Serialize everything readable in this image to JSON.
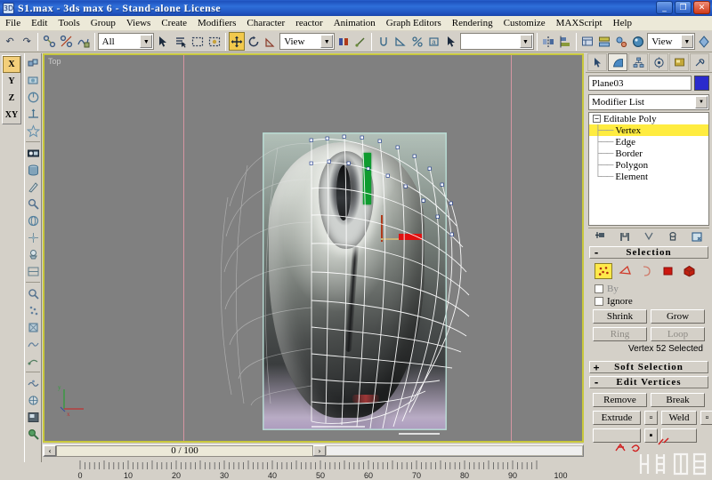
{
  "window": {
    "title": "S1.max - 3ds max 6 - Stand-alone License",
    "app_icon": "max-app-icon",
    "minimize_label": "_",
    "restore_label": "❐",
    "close_label": "✕"
  },
  "menu": {
    "items": [
      "File",
      "Edit",
      "Tools",
      "Group",
      "Views",
      "Create",
      "Modifiers",
      "Character",
      "reactor",
      "Animation",
      "Graph Editors",
      "Rendering",
      "Customize",
      "MAXScript",
      "Help"
    ]
  },
  "toolbar": {
    "undo": "↶",
    "redo": "↷",
    "select_link": "link-icon",
    "unlink": "unlink-icon",
    "bind_space_warp": "bind-icon",
    "selection_filter": "All",
    "select_object": "➤",
    "select_by_name": "name-icon",
    "rect_select": "rect-select-icon",
    "window_crossing": "crossing-icon",
    "select_move": "✥",
    "select_rotate": "↻",
    "select_scale": "scale-icon",
    "ref_coord_sys": "View",
    "use_pivot": "pivot-icon",
    "mirror": "mirror-icon",
    "align": "align-icon",
    "layers": "layers-icon",
    "curve_editor": "curve-icon",
    "schematic": "schematic-icon",
    "material_editor": "material-icon",
    "render_scene": "render-icon",
    "render_type": "View",
    "quick_render": "quick-render-icon",
    "named_selection_sets": ""
  },
  "axis_constraints": {
    "items": [
      "X",
      "Y",
      "Z",
      "XY"
    ],
    "active": "X"
  },
  "left_toolbar": {
    "icons": [
      "array-icon",
      "snapshot-icon",
      "spacing-icon",
      "align-normal-icon",
      "place-highlight-icon",
      "material-editor-icon",
      "render-scene-icon",
      "quick-render-icon",
      "render-last-icon",
      "environment-icon",
      "effects-icon",
      "advanced-lighting-icon",
      "ram-player-icon",
      "asset-browser-icon",
      "particle-view-icon",
      "reactor-icon",
      "tape-icon",
      "measure-icon",
      "channel-info-icon",
      "snaps-icon",
      "grid-icon",
      "display-floater-icon",
      "light-lister-icon"
    ]
  },
  "viewport": {
    "label": "Top",
    "active_border_color": "#c8c83c",
    "background_color": "#808080",
    "reference_image": "computer-mouse-photo",
    "mesh_object": "Plane03 editable poly wireframe",
    "tripod": {
      "x_label": "x",
      "y_label": "y",
      "x_color": "#c03030",
      "y_color": "#2f9c3a"
    }
  },
  "timeline": {
    "current_frame_text": "0 / 100",
    "prev_label": "‹",
    "next_label": "›",
    "ruler_labels": [
      "0",
      "10",
      "20",
      "30",
      "40",
      "50",
      "60",
      "70",
      "80",
      "90",
      "100"
    ],
    "range_start": 0,
    "range_end": 100,
    "slider_position": 0
  },
  "command_panel": {
    "tabs": [
      {
        "name": "create-tab",
        "glyph": "↖",
        "active": false
      },
      {
        "name": "modify-tab",
        "glyph": "◠",
        "active": true
      },
      {
        "name": "hierarchy-tab",
        "glyph": "⛓",
        "active": false
      },
      {
        "name": "motion-tab",
        "glyph": "◎",
        "active": false
      },
      {
        "name": "display-tab",
        "glyph": "▤",
        "active": false
      },
      {
        "name": "utilities-tab",
        "glyph": "⚒",
        "active": false
      }
    ],
    "object_name": "Plane03",
    "object_color": "#2a2acd",
    "modifier_list_label": "Modifier List",
    "stack": [
      {
        "label": "Editable Poly",
        "level": 0,
        "expanded": true,
        "selected": false
      },
      {
        "label": "Vertex",
        "level": 1,
        "selected": true
      },
      {
        "label": "Edge",
        "level": 1,
        "selected": false
      },
      {
        "label": "Border",
        "level": 1,
        "selected": false
      },
      {
        "label": "Polygon",
        "level": 1,
        "selected": false
      },
      {
        "label": "Element",
        "level": 1,
        "selected": false
      }
    ],
    "stack_tools": [
      "pin-stack-icon",
      "show-end-result-icon",
      "make-unique-icon",
      "remove-modifier-icon",
      "configure-sets-icon"
    ],
    "selection_rollout": {
      "title": "Selection",
      "sign": "-",
      "sub_object_icons": [
        {
          "name": "vertex-sub-object",
          "glyph": "∷",
          "active": true
        },
        {
          "name": "edge-sub-object",
          "glyph": "◁",
          "active": false
        },
        {
          "name": "border-sub-object",
          "glyph": "◖",
          "active": false
        },
        {
          "name": "polygon-sub-object",
          "glyph": "■",
          "active": false
        },
        {
          "name": "element-sub-object",
          "glyph": "⬢",
          "active": false
        }
      ],
      "by_vertex_label": "By",
      "ignore_backfacing_label": "Ignore",
      "shrink_label": "Shrink",
      "grow_label": "Grow",
      "ring_label": "Ring",
      "loop_label": "Loop",
      "status_text": "Vertex 52 Selected"
    },
    "soft_selection_rollout": {
      "title": "Soft Selection",
      "sign": "+"
    },
    "edit_vertices_rollout": {
      "title": "Edit Vertices",
      "sign": "-",
      "remove_label": "Remove",
      "break_label": "Break",
      "extrude_label": "Extrude",
      "weld_label": "Weld"
    }
  }
}
